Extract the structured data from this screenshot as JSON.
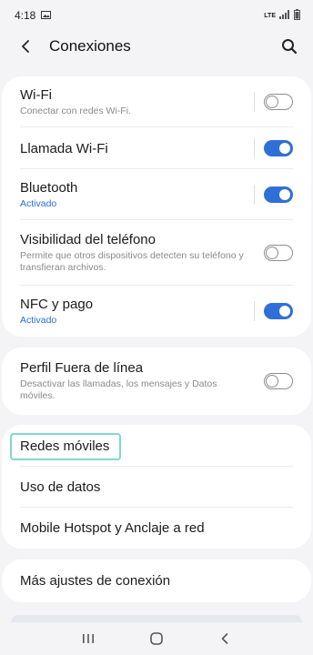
{
  "status_bar": {
    "time": "4:18",
    "network": "LTE"
  },
  "header": {
    "title": "Conexiones"
  },
  "cards": [
    {
      "items": [
        {
          "label": "Wi-Fi",
          "sub": "Conectar con redes Wi-Fi.",
          "toggle": "off"
        },
        {
          "label": "Llamada Wi-Fi",
          "sub": "",
          "toggle": "on"
        },
        {
          "label": "Bluetooth",
          "sub": "Activado",
          "toggle": "on"
        },
        {
          "label": "Visibilidad del teléfono",
          "sub": "Permite que otros dispositivos detecten su teléfono y transfieran archivos.",
          "toggle": "off"
        },
        {
          "label": "NFC y pago",
          "sub": "Activado",
          "toggle": "on"
        }
      ]
    },
    {
      "items": [
        {
          "label": "Perfil Fuera de línea",
          "sub": "Desactivar las llamadas, los mensajes y Datos móviles.",
          "toggle": "off"
        }
      ]
    },
    {
      "items": [
        {
          "label": "Redes móviles"
        },
        {
          "label": "Uso de datos"
        },
        {
          "label": "Mobile Hotspot y Anclaje a red"
        }
      ]
    },
    {
      "items": [
        {
          "label": "Más ajustes de conexión"
        }
      ]
    }
  ],
  "colors": {
    "accent": "#2f6fd8",
    "focus": "#7fd9cf",
    "background": "#f4f4f6"
  }
}
